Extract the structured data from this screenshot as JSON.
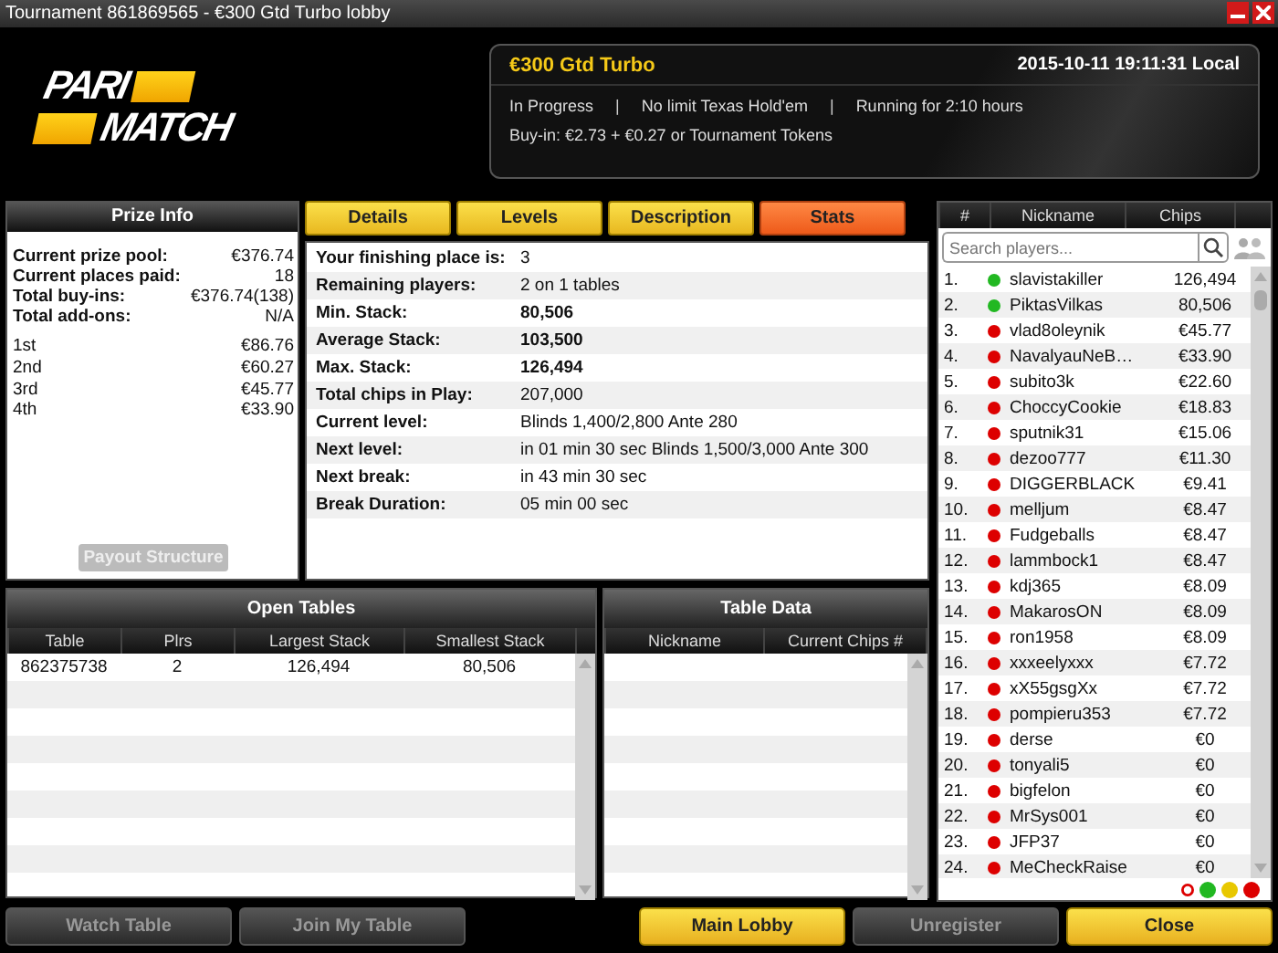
{
  "window": {
    "title": "Tournament 861869565 - €300 Gtd Turbo lobby"
  },
  "logo": {
    "line_1": "PARI",
    "line_2": "MATCH"
  },
  "tournament": {
    "name": "€300 Gtd Turbo",
    "datetime": "2015-10-11 19:11:31 Local",
    "status": "In Progress",
    "game": "No limit Texas Hold'em",
    "running": "Running for 2:10 hours",
    "separator": "|",
    "buyin": "Buy-in: €2.73 + €0.27 or Tournament Tokens"
  },
  "prize_info": {
    "title": "Prize Info",
    "summary": [
      {
        "label": "Current prize pool:",
        "value": "€376.74"
      },
      {
        "label": "Current places paid:",
        "value": "18"
      },
      {
        "label": "Total buy-ins:",
        "value": "€376.74(138)"
      },
      {
        "label": "Total add-ons:",
        "value": "N/A"
      }
    ],
    "places": [
      {
        "place": "1st",
        "amount": "€86.76"
      },
      {
        "place": "2nd",
        "amount": "€60.27"
      },
      {
        "place": "3rd",
        "amount": "€45.77"
      },
      {
        "place": "4th",
        "amount": "€33.90"
      }
    ],
    "button": {
      "label": "Payout Structure",
      "disabled": true
    }
  },
  "tabs": [
    {
      "label": "Details",
      "selected": false
    },
    {
      "label": "Levels",
      "selected": false
    },
    {
      "label": "Description",
      "selected": false
    },
    {
      "label": "Stats",
      "selected": true
    }
  ],
  "stats": [
    {
      "label": "Your finishing place is:",
      "value": "3",
      "bold": false
    },
    {
      "label": "Remaining players:",
      "value": "2 on 1 tables",
      "bold": false
    },
    {
      "label": "Min. Stack:",
      "value": "80,506",
      "bold": true
    },
    {
      "label": "Average Stack:",
      "value": "103,500",
      "bold": true
    },
    {
      "label": "Max. Stack:",
      "value": "126,494",
      "bold": true
    },
    {
      "label": "Total chips in Play:",
      "value": "207,000",
      "bold": false
    },
    {
      "label": "Current level:",
      "value": "Blinds 1,400/2,800 Ante 280",
      "bold": false
    },
    {
      "label": "Next level:",
      "value": "in 01 min 30 sec  Blinds 1,500/3,000 Ante 300",
      "bold": false
    },
    {
      "label": "Next break:",
      "value": "in 43 min 30 sec",
      "bold": false
    },
    {
      "label": "Break Duration:",
      "value": "05 min 00 sec",
      "bold": false
    }
  ],
  "open_tables": {
    "title": "Open Tables",
    "columns": [
      "Table",
      "Plrs",
      "Largest Stack",
      "Smallest Stack"
    ],
    "rows": [
      [
        "862375738",
        "2",
        "126,494",
        "80,506"
      ]
    ]
  },
  "table_data": {
    "title": "Table Data",
    "columns": [
      "Nickname",
      "Current Chips #"
    ]
  },
  "players": {
    "columns": [
      "#",
      "Nickname",
      "Chips"
    ],
    "search": {
      "placeholder": "Search players..."
    },
    "rows": [
      {
        "rank": "1.",
        "name": "slavistakiller",
        "chips": "126,494",
        "color": "#22b822"
      },
      {
        "rank": "2.",
        "name": "PiktasVilkas",
        "chips": "80,506",
        "color": "#22b822"
      },
      {
        "rank": "3.",
        "name": "vlad8oleynik",
        "chips": "€45.77",
        "color": "#dd0000"
      },
      {
        "rank": "4.",
        "name": "NavalyauNeB…",
        "chips": "€33.90",
        "color": "#dd0000"
      },
      {
        "rank": "5.",
        "name": "subito3k",
        "chips": "€22.60",
        "color": "#dd0000"
      },
      {
        "rank": "6.",
        "name": "ChoccyCookie",
        "chips": "€18.83",
        "color": "#dd0000"
      },
      {
        "rank": "7.",
        "name": "sputnik31",
        "chips": "€15.06",
        "color": "#dd0000"
      },
      {
        "rank": "8.",
        "name": "dezoo777",
        "chips": "€11.30",
        "color": "#dd0000"
      },
      {
        "rank": "9.",
        "name": "DIGGERBLACK",
        "chips": "€9.41",
        "color": "#dd0000"
      },
      {
        "rank": "10.",
        "name": "melljum",
        "chips": "€8.47",
        "color": "#dd0000"
      },
      {
        "rank": "11.",
        "name": "Fudgeballs",
        "chips": "€8.47",
        "color": "#dd0000"
      },
      {
        "rank": "12.",
        "name": "lammbock1",
        "chips": "€8.47",
        "color": "#dd0000"
      },
      {
        "rank": "13.",
        "name": "kdj365",
        "chips": "€8.09",
        "color": "#dd0000"
      },
      {
        "rank": "14.",
        "name": "MakarosON",
        "chips": "€8.09",
        "color": "#dd0000"
      },
      {
        "rank": "15.",
        "name": "ron1958",
        "chips": "€8.09",
        "color": "#dd0000"
      },
      {
        "rank": "16.",
        "name": "xxxeelyxxx",
        "chips": "€7.72",
        "color": "#dd0000"
      },
      {
        "rank": "17.",
        "name": "xX55gsgXx",
        "chips": "€7.72",
        "color": "#dd0000"
      },
      {
        "rank": "18.",
        "name": "pompieru353",
        "chips": "€7.72",
        "color": "#dd0000"
      },
      {
        "rank": "19.",
        "name": "derse",
        "chips": "€0",
        "color": "#dd0000"
      },
      {
        "rank": "20.",
        "name": "tonyali5",
        "chips": "€0",
        "color": "#dd0000"
      },
      {
        "rank": "21.",
        "name": "bigfelon",
        "chips": "€0",
        "color": "#dd0000"
      },
      {
        "rank": "22.",
        "name": "MrSys001",
        "chips": "€0",
        "color": "#dd0000"
      },
      {
        "rank": "23.",
        "name": "JFP37",
        "chips": "€0",
        "color": "#dd0000"
      },
      {
        "rank": "24.",
        "name": "MeCheckRaise",
        "chips": "€0",
        "color": "#dd0000"
      }
    ]
  },
  "buttons": [
    {
      "label": "Watch Table",
      "kind": "dark",
      "disabled": true
    },
    {
      "label": "Join My Table",
      "kind": "dark",
      "disabled": true
    },
    {
      "label": "Main Lobby",
      "kind": "yellow",
      "disabled": false
    },
    {
      "label": "Unregister",
      "kind": "dark",
      "disabled": true
    },
    {
      "label": "Close",
      "kind": "yellow",
      "disabled": false
    }
  ]
}
